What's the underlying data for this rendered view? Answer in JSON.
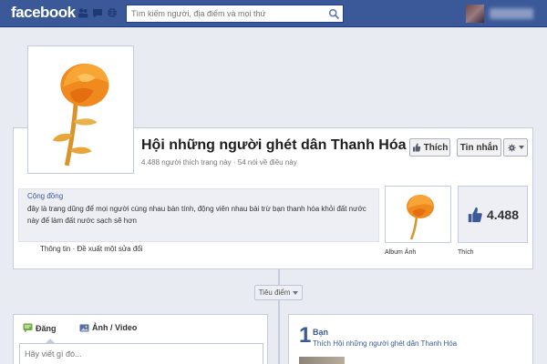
{
  "topbar": {
    "logo": "facebook",
    "search_placeholder": "Tìm kiếm người, địa điểm và mọi thứ",
    "brand_color": "#3b5998"
  },
  "page": {
    "title": "Hội những người ghét dân Thanh Hóa",
    "stats": "4.488 người thích trang này · 54 nói về điều này",
    "category": "Cộng đồng",
    "about": "đây là trang dũng để mọi người cùng nhau bàn tính, động viên nhau bài trừ bạn thanh hóa khỏi đất nước này để làm đất nước sạch sẽ hơn",
    "info_links": "Thông tin · Đề xuất một sửa đổi"
  },
  "actions": {
    "like_label": "Thích",
    "message_label": "Tin nhắn"
  },
  "tiles": {
    "album_label": "Album Ảnh",
    "likes_count": "4.488",
    "likes_label": "Thích"
  },
  "timeline": {
    "highlights_label": "Tiêu điểm"
  },
  "composer": {
    "post_tab": "Đăng",
    "photo_tab": "Ảnh / Video",
    "placeholder": "Hãy viết gì đó..."
  },
  "friends": {
    "count": "1",
    "title": "Bạn",
    "subtitle": "Thích Hội những người ghét dân Thanh Hóa"
  }
}
